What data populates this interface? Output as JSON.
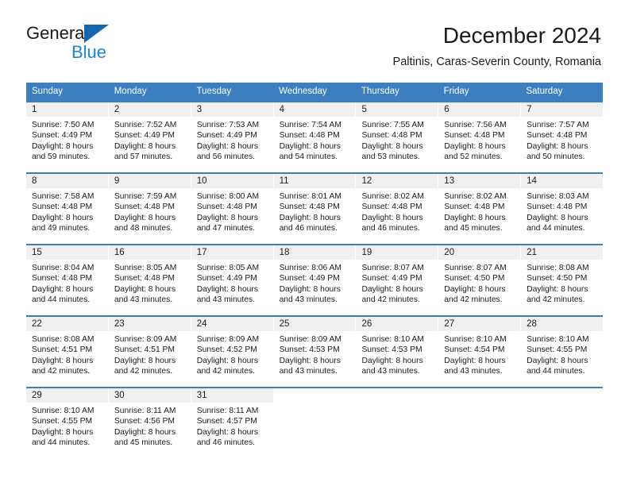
{
  "brand": {
    "name_part1": "General",
    "name_part2": "Blue",
    "flag_icon": "triangle-flag-icon"
  },
  "header": {
    "title": "December 2024",
    "subtitle": "Paltinis, Caras-Severin County, Romania"
  },
  "colors": {
    "header_blue": "#3c7fc0",
    "brand_dark_blue": "#1566ad",
    "brand_light_blue": "#1b87dc",
    "day_band_gray": "#f0f0f0",
    "text": "#1b1b1b"
  },
  "weekdays": [
    "Sunday",
    "Monday",
    "Tuesday",
    "Wednesday",
    "Thursday",
    "Friday",
    "Saturday"
  ],
  "weeks": [
    [
      {
        "day": "1",
        "sunrise": "Sunrise: 7:50 AM",
        "sunset": "Sunset: 4:49 PM",
        "daylight1": "Daylight: 8 hours",
        "daylight2": "and 59 minutes."
      },
      {
        "day": "2",
        "sunrise": "Sunrise: 7:52 AM",
        "sunset": "Sunset: 4:49 PM",
        "daylight1": "Daylight: 8 hours",
        "daylight2": "and 57 minutes."
      },
      {
        "day": "3",
        "sunrise": "Sunrise: 7:53 AM",
        "sunset": "Sunset: 4:49 PM",
        "daylight1": "Daylight: 8 hours",
        "daylight2": "and 56 minutes."
      },
      {
        "day": "4",
        "sunrise": "Sunrise: 7:54 AM",
        "sunset": "Sunset: 4:48 PM",
        "daylight1": "Daylight: 8 hours",
        "daylight2": "and 54 minutes."
      },
      {
        "day": "5",
        "sunrise": "Sunrise: 7:55 AM",
        "sunset": "Sunset: 4:48 PM",
        "daylight1": "Daylight: 8 hours",
        "daylight2": "and 53 minutes."
      },
      {
        "day": "6",
        "sunrise": "Sunrise: 7:56 AM",
        "sunset": "Sunset: 4:48 PM",
        "daylight1": "Daylight: 8 hours",
        "daylight2": "and 52 minutes."
      },
      {
        "day": "7",
        "sunrise": "Sunrise: 7:57 AM",
        "sunset": "Sunset: 4:48 PM",
        "daylight1": "Daylight: 8 hours",
        "daylight2": "and 50 minutes."
      }
    ],
    [
      {
        "day": "8",
        "sunrise": "Sunrise: 7:58 AM",
        "sunset": "Sunset: 4:48 PM",
        "daylight1": "Daylight: 8 hours",
        "daylight2": "and 49 minutes."
      },
      {
        "day": "9",
        "sunrise": "Sunrise: 7:59 AM",
        "sunset": "Sunset: 4:48 PM",
        "daylight1": "Daylight: 8 hours",
        "daylight2": "and 48 minutes."
      },
      {
        "day": "10",
        "sunrise": "Sunrise: 8:00 AM",
        "sunset": "Sunset: 4:48 PM",
        "daylight1": "Daylight: 8 hours",
        "daylight2": "and 47 minutes."
      },
      {
        "day": "11",
        "sunrise": "Sunrise: 8:01 AM",
        "sunset": "Sunset: 4:48 PM",
        "daylight1": "Daylight: 8 hours",
        "daylight2": "and 46 minutes."
      },
      {
        "day": "12",
        "sunrise": "Sunrise: 8:02 AM",
        "sunset": "Sunset: 4:48 PM",
        "daylight1": "Daylight: 8 hours",
        "daylight2": "and 46 minutes."
      },
      {
        "day": "13",
        "sunrise": "Sunrise: 8:02 AM",
        "sunset": "Sunset: 4:48 PM",
        "daylight1": "Daylight: 8 hours",
        "daylight2": "and 45 minutes."
      },
      {
        "day": "14",
        "sunrise": "Sunrise: 8:03 AM",
        "sunset": "Sunset: 4:48 PM",
        "daylight1": "Daylight: 8 hours",
        "daylight2": "and 44 minutes."
      }
    ],
    [
      {
        "day": "15",
        "sunrise": "Sunrise: 8:04 AM",
        "sunset": "Sunset: 4:48 PM",
        "daylight1": "Daylight: 8 hours",
        "daylight2": "and 44 minutes."
      },
      {
        "day": "16",
        "sunrise": "Sunrise: 8:05 AM",
        "sunset": "Sunset: 4:48 PM",
        "daylight1": "Daylight: 8 hours",
        "daylight2": "and 43 minutes."
      },
      {
        "day": "17",
        "sunrise": "Sunrise: 8:05 AM",
        "sunset": "Sunset: 4:49 PM",
        "daylight1": "Daylight: 8 hours",
        "daylight2": "and 43 minutes."
      },
      {
        "day": "18",
        "sunrise": "Sunrise: 8:06 AM",
        "sunset": "Sunset: 4:49 PM",
        "daylight1": "Daylight: 8 hours",
        "daylight2": "and 43 minutes."
      },
      {
        "day": "19",
        "sunrise": "Sunrise: 8:07 AM",
        "sunset": "Sunset: 4:49 PM",
        "daylight1": "Daylight: 8 hours",
        "daylight2": "and 42 minutes."
      },
      {
        "day": "20",
        "sunrise": "Sunrise: 8:07 AM",
        "sunset": "Sunset: 4:50 PM",
        "daylight1": "Daylight: 8 hours",
        "daylight2": "and 42 minutes."
      },
      {
        "day": "21",
        "sunrise": "Sunrise: 8:08 AM",
        "sunset": "Sunset: 4:50 PM",
        "daylight1": "Daylight: 8 hours",
        "daylight2": "and 42 minutes."
      }
    ],
    [
      {
        "day": "22",
        "sunrise": "Sunrise: 8:08 AM",
        "sunset": "Sunset: 4:51 PM",
        "daylight1": "Daylight: 8 hours",
        "daylight2": "and 42 minutes."
      },
      {
        "day": "23",
        "sunrise": "Sunrise: 8:09 AM",
        "sunset": "Sunset: 4:51 PM",
        "daylight1": "Daylight: 8 hours",
        "daylight2": "and 42 minutes."
      },
      {
        "day": "24",
        "sunrise": "Sunrise: 8:09 AM",
        "sunset": "Sunset: 4:52 PM",
        "daylight1": "Daylight: 8 hours",
        "daylight2": "and 42 minutes."
      },
      {
        "day": "25",
        "sunrise": "Sunrise: 8:09 AM",
        "sunset": "Sunset: 4:53 PM",
        "daylight1": "Daylight: 8 hours",
        "daylight2": "and 43 minutes."
      },
      {
        "day": "26",
        "sunrise": "Sunrise: 8:10 AM",
        "sunset": "Sunset: 4:53 PM",
        "daylight1": "Daylight: 8 hours",
        "daylight2": "and 43 minutes."
      },
      {
        "day": "27",
        "sunrise": "Sunrise: 8:10 AM",
        "sunset": "Sunset: 4:54 PM",
        "daylight1": "Daylight: 8 hours",
        "daylight2": "and 43 minutes."
      },
      {
        "day": "28",
        "sunrise": "Sunrise: 8:10 AM",
        "sunset": "Sunset: 4:55 PM",
        "daylight1": "Daylight: 8 hours",
        "daylight2": "and 44 minutes."
      }
    ],
    [
      {
        "day": "29",
        "sunrise": "Sunrise: 8:10 AM",
        "sunset": "Sunset: 4:55 PM",
        "daylight1": "Daylight: 8 hours",
        "daylight2": "and 44 minutes."
      },
      {
        "day": "30",
        "sunrise": "Sunrise: 8:11 AM",
        "sunset": "Sunset: 4:56 PM",
        "daylight1": "Daylight: 8 hours",
        "daylight2": "and 45 minutes."
      },
      {
        "day": "31",
        "sunrise": "Sunrise: 8:11 AM",
        "sunset": "Sunset: 4:57 PM",
        "daylight1": "Daylight: 8 hours",
        "daylight2": "and 46 minutes."
      },
      {
        "day": "",
        "sunrise": "",
        "sunset": "",
        "daylight1": "",
        "daylight2": ""
      },
      {
        "day": "",
        "sunrise": "",
        "sunset": "",
        "daylight1": "",
        "daylight2": ""
      },
      {
        "day": "",
        "sunrise": "",
        "sunset": "",
        "daylight1": "",
        "daylight2": ""
      },
      {
        "day": "",
        "sunrise": "",
        "sunset": "",
        "daylight1": "",
        "daylight2": ""
      }
    ]
  ]
}
